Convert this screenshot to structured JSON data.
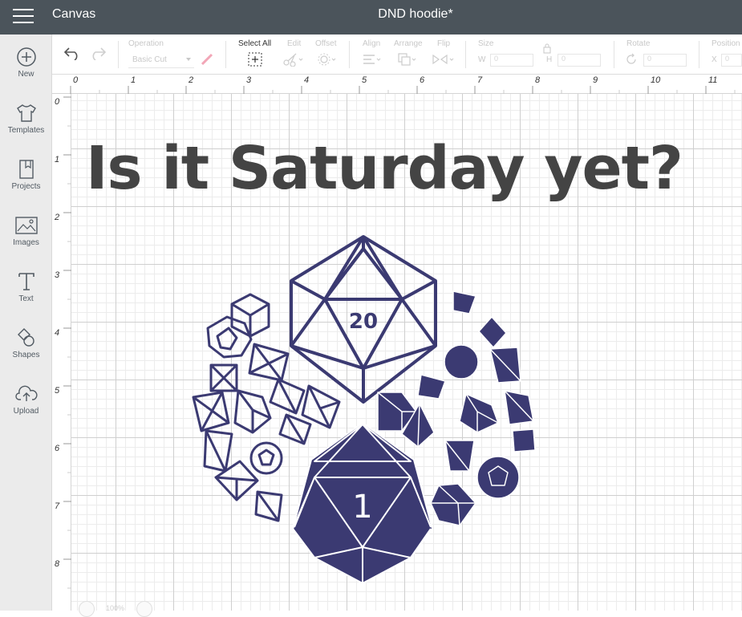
{
  "header": {
    "app_title": "Canvas",
    "document_title": "DND hoodie*"
  },
  "sidebar": {
    "items": [
      {
        "label": "New",
        "icon": "plus-circle-icon"
      },
      {
        "label": "Templates",
        "icon": "tshirt-icon"
      },
      {
        "label": "Projects",
        "icon": "bookmark-icon"
      },
      {
        "label": "Images",
        "icon": "image-icon"
      },
      {
        "label": "Text",
        "icon": "text-icon"
      },
      {
        "label": "Shapes",
        "icon": "shapes-icon"
      },
      {
        "label": "Upload",
        "icon": "cloud-upload-icon"
      }
    ]
  },
  "toolbar": {
    "operation_label": "Operation",
    "operation_value": "Basic Cut",
    "select_all_label": "Select All",
    "edit_label": "Edit",
    "offset_label": "Offset",
    "align_label": "Align",
    "arrange_label": "Arrange",
    "flip_label": "Flip",
    "size_label": "Size",
    "w_label": "W",
    "w_value": "0",
    "h_label": "H",
    "h_value": "0",
    "rotate_label": "Rotate",
    "rotate_value": "0",
    "position_label": "Position",
    "x_label": "X",
    "x_value": "0"
  },
  "rulers": {
    "top": [
      "0",
      "1",
      "2",
      "3",
      "4",
      "5",
      "6",
      "7",
      "8",
      "9",
      "10",
      "11"
    ],
    "left": [
      "0",
      "1",
      "2",
      "3",
      "4",
      "5",
      "6",
      "7",
      "8"
    ]
  },
  "design": {
    "headline": "Is it Saturday yet?",
    "d20_top_number": "20",
    "d20_bottom_number": "1",
    "colors": {
      "dice": "#3b3a72",
      "text": "#444444",
      "topbar": "#4b545b"
    }
  },
  "zoom": {
    "value": "100%"
  }
}
